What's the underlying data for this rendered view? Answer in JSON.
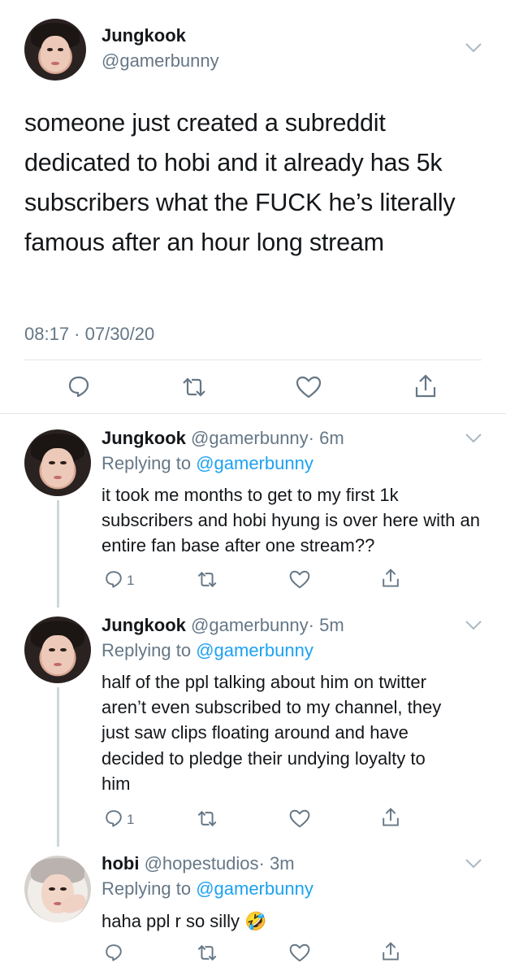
{
  "main_tweet": {
    "display_name": "Jungkook",
    "handle": "@gamerbunny",
    "text": "someone just created a subreddit dedicated to hobi and it already has 5k subscribers what the FUCK he’s literally famous after an hour long stream",
    "timestamp": "08:17 · 07/30/20"
  },
  "replies": [
    {
      "display_name": "Jungkook",
      "handle": "@gamerbunny",
      "time": "· 6m",
      "replying_prefix": "Replying to ",
      "replying_to": "@gamerbunny",
      "text": "it took me months to get to my first 1k subscribers and hobi hyung is over here with an entire fan base after one stream??",
      "reply_count": "1"
    },
    {
      "display_name": "Jungkook",
      "handle": "@gamerbunny",
      "time": "· 5m",
      "replying_prefix": "Replying to ",
      "replying_to": "@gamerbunny",
      "text": "half of the ppl talking about him on twitter aren’t even subscribed to my channel, they just saw clips floating around and have decided to pledge their undying loyalty to him",
      "reply_count": "1"
    },
    {
      "display_name": "hobi",
      "handle": "@hopestudios",
      "time": "· 3m",
      "replying_prefix": "Replying to ",
      "replying_to": "@gamerbunny",
      "text": "haha ppl r so silly",
      "emoji": "🤣",
      "reply_count": ""
    }
  ],
  "icons": [
    "reply-icon",
    "retweet-icon",
    "like-icon",
    "share-icon",
    "chevron-down-icon"
  ],
  "colors": {
    "text": "#14171a",
    "secondary": "#657786",
    "link": "#1da1f2",
    "divider": "#e1e8ed"
  }
}
